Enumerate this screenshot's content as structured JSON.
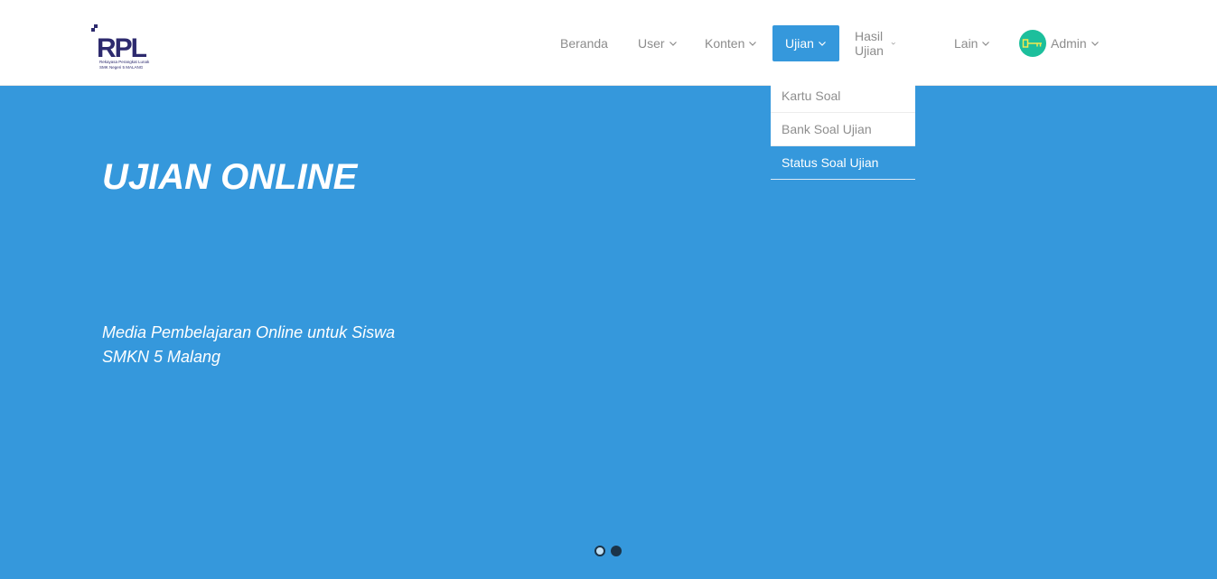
{
  "logo": {
    "text": "RPL",
    "tagline": "Rekayasa Perangkat Lunak",
    "school": "SMK Negeri 5 MALANG"
  },
  "nav": {
    "items": [
      {
        "label": "Beranda",
        "has_dropdown": false
      },
      {
        "label": "User",
        "has_dropdown": true
      },
      {
        "label": "Konten",
        "has_dropdown": true
      },
      {
        "label": "Ujian",
        "has_dropdown": true,
        "active": true
      },
      {
        "label": "Hasil Ujian",
        "has_dropdown": true
      },
      {
        "label": "Lain",
        "has_dropdown": true
      }
    ],
    "user": {
      "label": "Admin",
      "avatar_icon": "key-icon"
    }
  },
  "dropdown": {
    "items": [
      {
        "label": "Kartu Soal"
      },
      {
        "label": "Bank Soal Ujian"
      },
      {
        "label": "Status Soal Ujian",
        "highlighted": true
      }
    ]
  },
  "hero": {
    "title": "UJIAN ONLINE",
    "subtitle_line1": "Media Pembelajaran Online untuk Siswa",
    "subtitle_line2": "SMKN 5 Malang"
  },
  "carousel": {
    "slides": 2,
    "current": 1
  },
  "colors": {
    "primary": "#3598dc",
    "avatar": "#1cbf9c",
    "nav_text": "#8c8c8c"
  }
}
